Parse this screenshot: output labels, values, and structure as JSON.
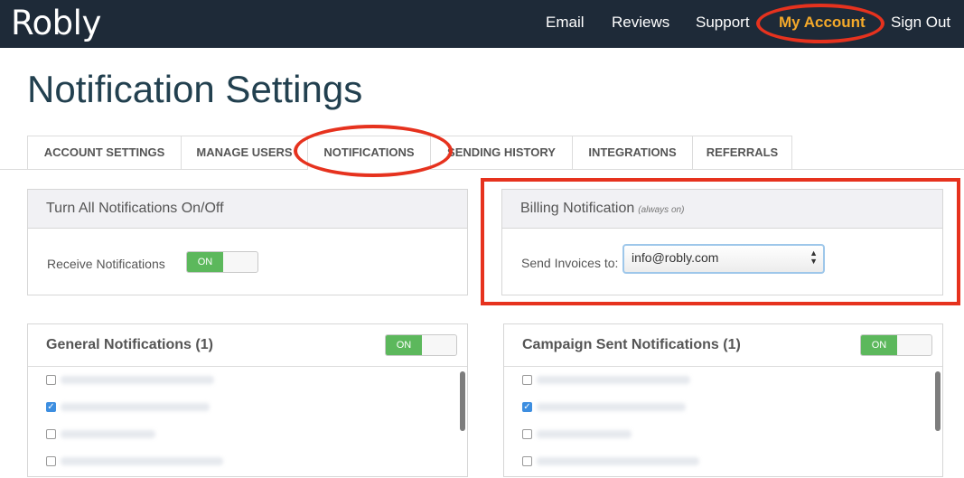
{
  "header": {
    "logo": "Robly",
    "nav": [
      {
        "label": "Email"
      },
      {
        "label": "Reviews"
      },
      {
        "label": "Support"
      },
      {
        "label": "My Account",
        "active": true
      },
      {
        "label": "Sign Out"
      }
    ]
  },
  "page": {
    "title": "Notification Settings"
  },
  "tabs": [
    {
      "label": "Account Settings"
    },
    {
      "label": "Manage Users"
    },
    {
      "label": "Notifications",
      "active": true
    },
    {
      "label": "Sending History"
    },
    {
      "label": "Integrations"
    },
    {
      "label": "Referrals"
    }
  ],
  "all_notifications": {
    "title": "Turn All Notifications On/Off",
    "receive_label": "Receive Notifications",
    "toggle": "ON"
  },
  "billing": {
    "title": "Billing Notification",
    "hint": "(always on)",
    "send_label": "Send Invoices to:",
    "selected": "info@robly.com"
  },
  "general": {
    "title": "General Notifications (1)",
    "toggle": "ON",
    "checkboxes": [
      false,
      true,
      false,
      false
    ]
  },
  "campaign": {
    "title": "Campaign Sent Notifications (1)",
    "toggle": "ON",
    "checkboxes": [
      false,
      true,
      false,
      false
    ]
  },
  "colors": {
    "topbar": "#1e2a38",
    "accent": "#f4a92a",
    "toggle_on": "#5cb85c",
    "annotation": "#e6321e",
    "checkbox": "#3d8ee0"
  }
}
